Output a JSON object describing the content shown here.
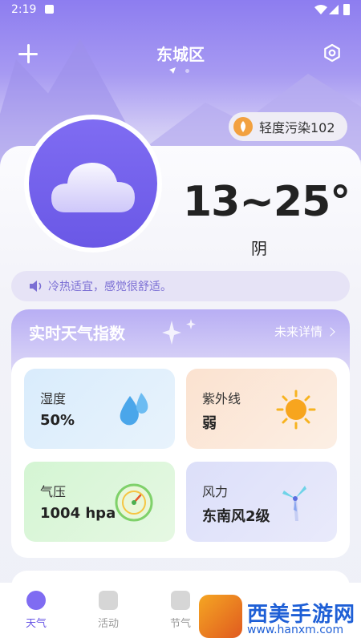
{
  "status_bar": {
    "time": "2:19"
  },
  "header": {
    "city": "东城区"
  },
  "air_quality": {
    "label": "轻度污染102"
  },
  "current": {
    "temperature": "13~25°",
    "condition": "阴"
  },
  "tip": {
    "text": "冷热适宜，感觉很舒适。"
  },
  "index_panel": {
    "title": "实时天气指数",
    "more_label": "未来详情",
    "tiles": [
      {
        "label": "湿度",
        "value": "50%",
        "icon": "water-drops-icon"
      },
      {
        "label": "紫外线",
        "value": "弱",
        "icon": "sun-icon"
      },
      {
        "label": "气压",
        "value": "1004 hpa",
        "icon": "gauge-icon"
      },
      {
        "label": "风力",
        "value": "东南风2级",
        "icon": "wind-turbine-icon"
      }
    ]
  },
  "tabbar": {
    "items": [
      {
        "label": "天气",
        "icon": "weather-icon",
        "active": true
      },
      {
        "label": "活动",
        "icon": "calendar-icon"
      },
      {
        "label": "节气",
        "icon": "cloud-icon"
      }
    ]
  },
  "watermark": {
    "name": "西美手游网",
    "url": "www.hanxm.com"
  },
  "colors": {
    "accent": "#6a58e6",
    "tip_text": "#7b6fd4",
    "aqi": "#f2a140"
  }
}
